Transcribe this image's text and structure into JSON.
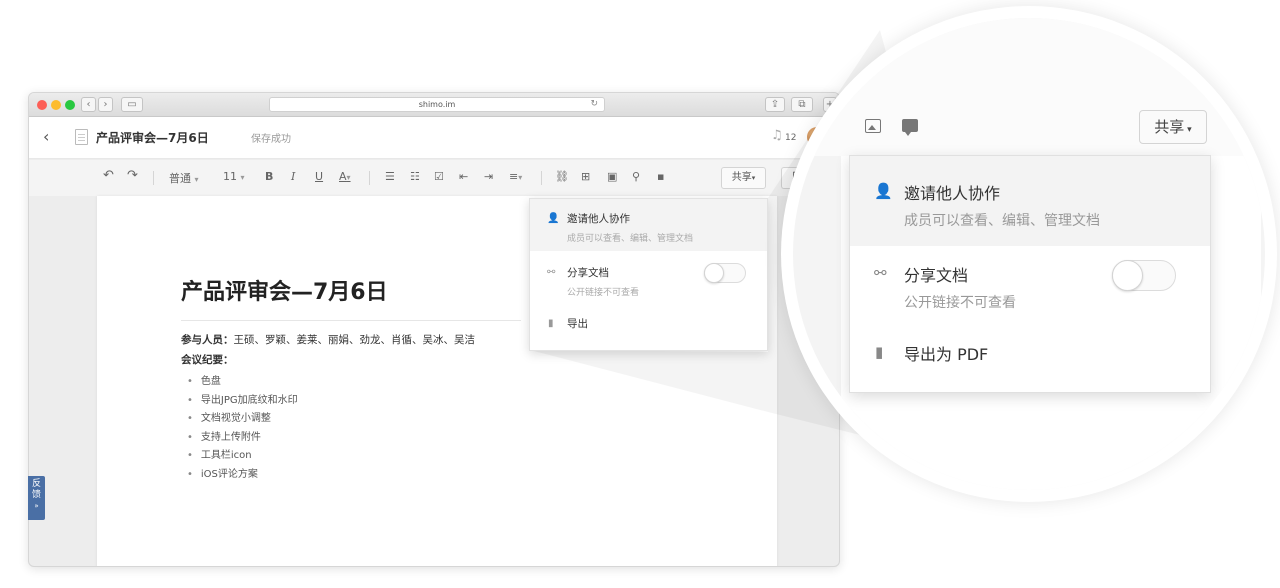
{
  "browser": {
    "url": "shimo.im",
    "reload_icon": "reload-icon",
    "back_icon": "nav-back-icon",
    "forward_icon": "nav-forward-icon"
  },
  "header": {
    "doc_title": "产品评审会—7月6日",
    "save_status": "保存成功",
    "notification_count": "12"
  },
  "toolbar": {
    "undo": "↶",
    "redo": "↷",
    "style": "普通",
    "font_size": "11",
    "bold": "B",
    "italic": "I",
    "underline": "U",
    "font_color": "A",
    "share": "共享",
    "history": "历史"
  },
  "document": {
    "title": "产品评审会—7月6日",
    "attendees_label": "参与人员：",
    "attendees": "王硕、罗颖、姜莱、丽娟、劲龙、肖循、吴冰、吴洁",
    "minutes_label": "会议纪要：",
    "items": [
      "色盘",
      "导出JPG加底纹和水印",
      "文档视觉小调整",
      "支持上传附件",
      "工具栏icon",
      "iOS评论方案"
    ]
  },
  "feedback": {
    "label_1": "反",
    "label_2": "馈",
    "arrow": "»"
  },
  "share_menu": {
    "invite_title": "邀请他人协作",
    "invite_desc": "成员可以查看、编辑、管理文档",
    "share_title": "分享文档",
    "share_desc": "公开链接不可查看",
    "share_enabled": false,
    "export_small": "导出",
    "export_large": "导出为 PDF"
  },
  "magnifier": {
    "share_button": "共享"
  }
}
